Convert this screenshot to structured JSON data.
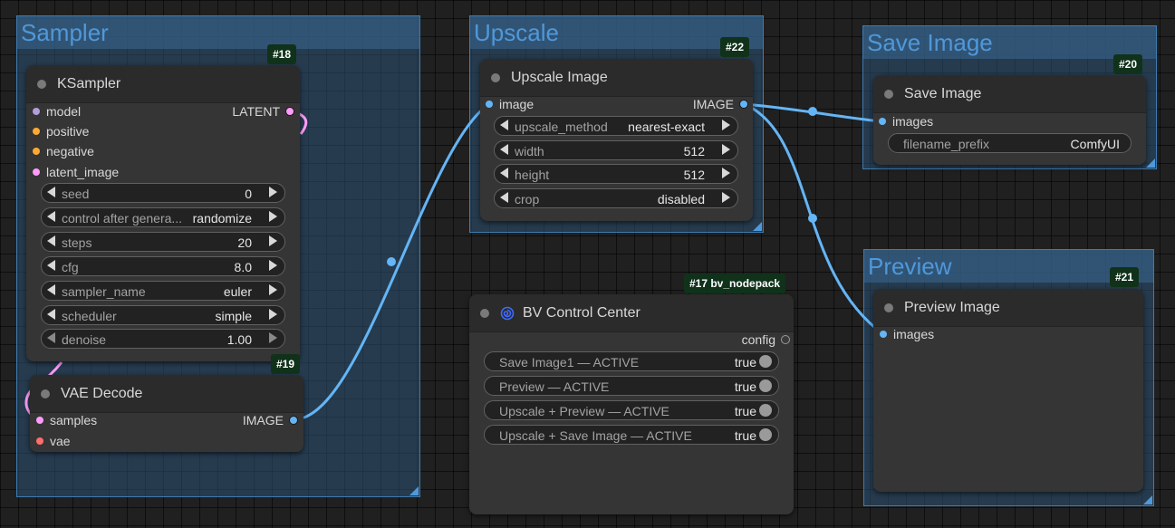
{
  "groups": {
    "sampler": {
      "title": "Sampler"
    },
    "upscale": {
      "title": "Upscale"
    },
    "save": {
      "title": "Save Image"
    },
    "preview": {
      "title": "Preview"
    }
  },
  "colors": {
    "latent": "#ff9cf9",
    "conditioning": "#ffa931",
    "image": "#64b5f6",
    "vae": "#ff6e6e",
    "model": "#b39ddb",
    "wire_image": "#64b5f6",
    "wire_latent": "#ff9cf9",
    "group_accent": "#4f98da",
    "badge_bg": "#10321a",
    "logo": "#3d6bff"
  },
  "nodes": {
    "ksampler": {
      "badge": "#18",
      "title": "KSampler",
      "inputs": [
        "model",
        "positive",
        "negative",
        "latent_image"
      ],
      "output": "LATENT",
      "widgets": [
        {
          "label": "seed",
          "value": "0"
        },
        {
          "label": "control after genera...",
          "value": "randomize"
        },
        {
          "label": "steps",
          "value": "20"
        },
        {
          "label": "cfg",
          "value": "8.0"
        },
        {
          "label": "sampler_name",
          "value": "euler"
        },
        {
          "label": "scheduler",
          "value": "simple"
        },
        {
          "label": "denoise",
          "value": "1.00"
        }
      ]
    },
    "vae_decode": {
      "badge": "#19",
      "title": "VAE Decode",
      "inputs": [
        "samples",
        "vae"
      ],
      "output": "IMAGE"
    },
    "upscale_image": {
      "badge": "#22",
      "title": "Upscale Image",
      "input": "image",
      "output": "IMAGE",
      "widgets": [
        {
          "label": "upscale_method",
          "value": "nearest-exact"
        },
        {
          "label": "width",
          "value": "512"
        },
        {
          "label": "height",
          "value": "512"
        },
        {
          "label": "crop",
          "value": "disabled"
        }
      ]
    },
    "save_image": {
      "badge": "#20",
      "title": "Save Image",
      "input": "images",
      "widget": {
        "label": "filename_prefix",
        "value": "ComfyUI"
      }
    },
    "preview_image": {
      "badge": "#21",
      "title": "Preview Image",
      "input": "images"
    },
    "bv_control": {
      "badge": "#17 bv_nodepack",
      "title": "BV Control Center",
      "logo_icon": "spiral-logo-icon",
      "output": "config",
      "toggles": [
        {
          "label": "Save Image1 — ACTIVE",
          "value": "true"
        },
        {
          "label": "Preview — ACTIVE",
          "value": "true"
        },
        {
          "label": "Upscale + Preview — ACTIVE",
          "value": "true"
        },
        {
          "label": "Upscale + Save Image — ACTIVE",
          "value": "true"
        }
      ]
    }
  }
}
